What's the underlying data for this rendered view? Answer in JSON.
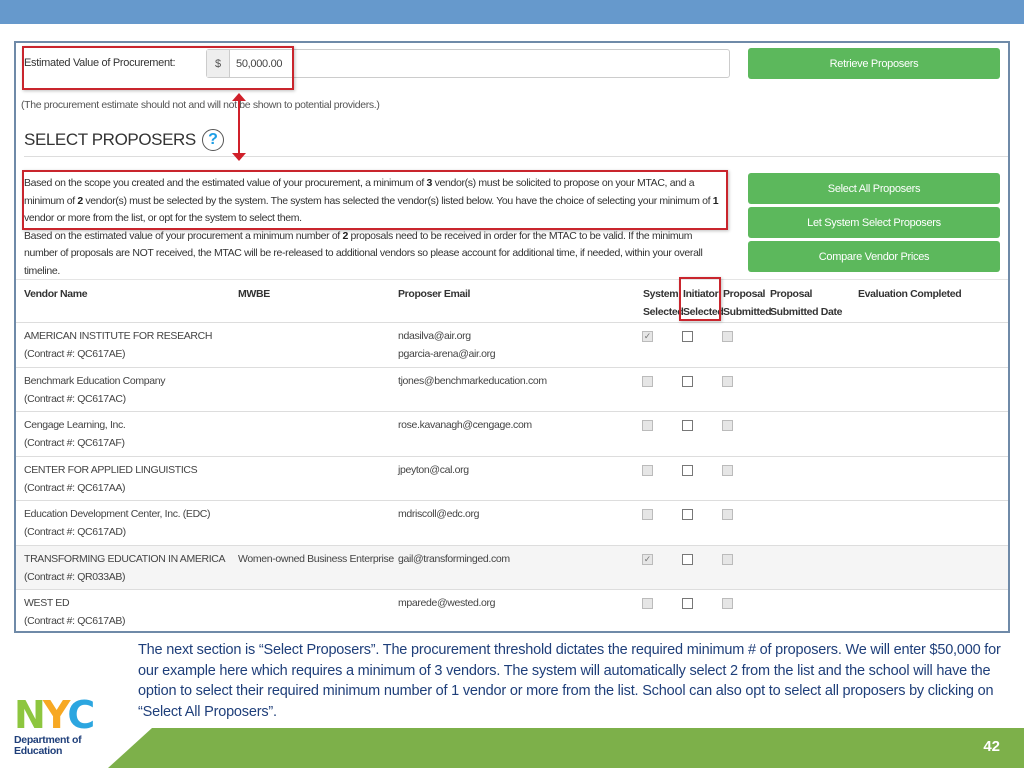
{
  "slide": {
    "caption": "The next section is “Select Proposers”. The procurement threshold dictates the required minimum # of proposers. We will enter $50,000 for our example here which requires a minimum of 3 vendors.  The system will automatically select 2 from the list and the school will have the option to select their required minimum number of 1 vendor or more from the list.  School can also opt to select all proposers by clicking on “Select All Proposers”.",
    "page_number": "42",
    "logo": {
      "letters": [
        "N",
        "Y",
        "C"
      ],
      "letter_colors": [
        "#8dc63f",
        "#f7a823",
        "#2ca6e0"
      ],
      "line1": "Department of",
      "line2": "Education"
    },
    "colors": {
      "top_bar": "#6699cc",
      "footer_green": "#7db04a",
      "annotation_red": "#c9252d",
      "caption_text": "#1f3f7a"
    }
  },
  "estimate": {
    "label": "Estimated Value of Procurement:",
    "currency_symbol": "$",
    "value": "50,000.00",
    "note": "(The procurement estimate should not and will not be shown to potential providers.)",
    "retrieve_button": "Retrieve Proposers"
  },
  "section": {
    "title": "SELECT PROPOSERS",
    "help_icon": "?",
    "info_parts": [
      "Based on the scope you created and the estimated value of your procurement, a minimum of ",
      "3",
      " vendor(s) must be solicited to propose on your MTAC, and a minimum of ",
      "2",
      " vendor(s) must be selected by the system. The system has selected the vendor(s) listed below. You have the choice of selecting your minimum of ",
      "1",
      " vendor or more from the list, or opt for the system to select them."
    ],
    "info2_parts": [
      "Based on the estimated value of your procurement a minimum number of ",
      "2",
      " proposals need to be received in order for the MTAC to be valid. If the minimum number of proposals are NOT received, the MTAC will be re-released to additional vendors so please account for additional time, if needed, within your overall timeline."
    ],
    "buttons": {
      "select_all": "Select All Proposers",
      "system_select": "Let System Select Proposers",
      "compare_prices": "Compare Vendor Prices"
    }
  },
  "table": {
    "headers": {
      "vendor": "Vendor Name",
      "mwbe": "MWBE",
      "email": "Proposer Email",
      "system_selected_1": "System",
      "system_selected_2": "Selected",
      "initiator_selected_1": "Initiator",
      "initiator_selected_2": "Selected",
      "proposal_submitted_1": "Proposal",
      "proposal_submitted_2": "Submitted",
      "submitted_date_1": "Proposal",
      "submitted_date_2": "Submitted Date",
      "evaluation": "Evaluation Completed"
    },
    "rows": [
      {
        "vendor": "AMERICAN INSTITUTE FOR RESEARCH",
        "contract": "(Contract #: QC617AE)",
        "mwbe": "",
        "email": "ndasilva@air.org",
        "email2": "pgarcia-arena@air.org",
        "system_selected": true,
        "initiator_selected": false,
        "proposal_submitted": false,
        "submitted_date": "",
        "evaluation": ""
      },
      {
        "vendor": "Benchmark Education Company",
        "contract": "(Contract #: QC617AC)",
        "mwbe": "",
        "email": "tjones@benchmarkeducation.com",
        "email2": "",
        "system_selected": false,
        "initiator_selected": false,
        "proposal_submitted": false,
        "submitted_date": "",
        "evaluation": ""
      },
      {
        "vendor": "Cengage Learning, Inc.",
        "contract": "(Contract #: QC617AF)",
        "mwbe": "",
        "email": "rose.kavanagh@cengage.com",
        "email2": "",
        "system_selected": false,
        "initiator_selected": false,
        "proposal_submitted": false,
        "submitted_date": "",
        "evaluation": ""
      },
      {
        "vendor": "CENTER FOR APPLIED LINGUISTICS",
        "contract": "(Contract #: QC617AA)",
        "mwbe": "",
        "email": "jpeyton@cal.org",
        "email2": "",
        "system_selected": false,
        "initiator_selected": false,
        "proposal_submitted": false,
        "submitted_date": "",
        "evaluation": ""
      },
      {
        "vendor": "Education Development Center, Inc. (EDC)",
        "contract": "(Contract #: QC617AD)",
        "mwbe": "",
        "email": "mdriscoll@edc.org",
        "email2": "",
        "system_selected": false,
        "initiator_selected": false,
        "proposal_submitted": false,
        "submitted_date": "",
        "evaluation": ""
      },
      {
        "vendor": "TRANSFORMING EDUCATION IN AMERICA",
        "contract": "(Contract #: QR033AB)",
        "mwbe": "Women-owned Business Enterprise",
        "email": "gail@transforminged.com",
        "email2": "",
        "system_selected": true,
        "initiator_selected": false,
        "proposal_submitted": false,
        "submitted_date": "",
        "evaluation": ""
      },
      {
        "vendor": "WEST ED",
        "contract": "(Contract #: QC617AB)",
        "mwbe": "",
        "email": "mparede@wested.org",
        "email2": "",
        "system_selected": false,
        "initiator_selected": false,
        "proposal_submitted": false,
        "submitted_date": "",
        "evaluation": ""
      }
    ]
  }
}
